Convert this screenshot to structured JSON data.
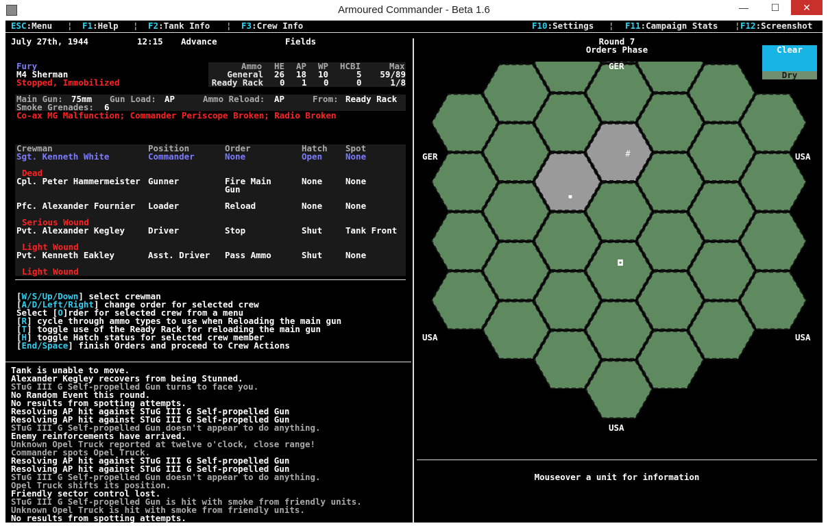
{
  "window": {
    "title": "Armoured Commander - Beta 1.6",
    "minimize": "—",
    "maximize": "☐",
    "close": "✕"
  },
  "menu": {
    "left": [
      {
        "key": "ESC",
        "label": ":Menu"
      },
      {
        "key": "F1",
        "label": ":Help"
      },
      {
        "key": "F2",
        "label": ":Tank Info"
      },
      {
        "key": "F3",
        "label": ":Crew Info"
      }
    ],
    "right": [
      {
        "key": "F10",
        "label": ":Settings"
      },
      {
        "key": "F11",
        "label": ":Campaign Stats"
      },
      {
        "key": "F12",
        "label": ":Screenshot"
      }
    ]
  },
  "status": {
    "date": "July 27th, 1944",
    "time": "12:15",
    "mission": "Advance",
    "terrain": "Fields"
  },
  "tank": {
    "name": "Fury",
    "model": "M4 Sherman",
    "state": "Stopped, Immobilized",
    "ammo_headers": [
      "Ammo",
      "HE",
      "AP",
      "WP",
      "HCBI",
      "Max"
    ],
    "ammo_rows": [
      {
        "label": "General",
        "he": "26",
        "ap": "18",
        "wp": "10",
        "hcbi": "5",
        "max": "59/89"
      },
      {
        "label": "Ready Rack",
        "he": "0",
        "ap": "1",
        "wp": "0",
        "hcbi": "0",
        "max": "1/8"
      }
    ],
    "main_gun_label": "Main Gun:",
    "main_gun": "75mm",
    "gun_load_label": "Gun Load:",
    "gun_load": "AP",
    "ammo_reload_label": "Ammo Reload:",
    "ammo_reload": "AP",
    "from_label": "From:",
    "from": "Ready Rack",
    "smoke_label": "Smoke Grenades:",
    "smoke": "6",
    "malfunctions": "Co-ax MG Malfunction; Commander Periscope Broken; Radio Broken"
  },
  "crew": {
    "headers": [
      "Crewman",
      "Position",
      "Order",
      "Hatch",
      "Spot"
    ],
    "rows": [
      {
        "name": "Sgt. Kenneth White",
        "position": "Commander",
        "order": "None",
        "order2": "",
        "hatch": "Open",
        "spot": "None",
        "status": "Dead",
        "selected": true
      },
      {
        "name": "Cpl. Peter Hammermeister",
        "position": "Gunner",
        "order": "Fire Main",
        "order2": "Gun",
        "hatch": "None",
        "spot": "None",
        "status": "",
        "selected": false
      },
      {
        "name": "Pfc. Alexander Fournier",
        "position": "Loader",
        "order": "Reload",
        "order2": "",
        "hatch": "None",
        "spot": "None",
        "status": "Serious Wound",
        "selected": false
      },
      {
        "name": "Pvt. Alexander Kegley",
        "position": "Driver",
        "order": "Stop",
        "order2": "",
        "hatch": "Shut",
        "spot": "Tank Front",
        "status": "Light Wound",
        "selected": false
      },
      {
        "name": "Pvt. Kenneth Eakley",
        "position": "Asst. Driver",
        "order": "Pass Ammo",
        "order2": "",
        "hatch": "Shut",
        "spot": "None",
        "status": "Light Wound",
        "selected": false
      }
    ]
  },
  "help": [
    {
      "pre": "[",
      "key": "W/S/Up/Down",
      "post": "] select crewman"
    },
    {
      "pre": "[",
      "key": "A/D/Left/Right",
      "post": "] change order for selected crew"
    },
    {
      "pre": "Select [",
      "key": "O",
      "post": "]rder for selected crew from a menu"
    },
    {
      "pre": "[",
      "key": "R",
      "post": "] cycle through ammo types to use when Reloading the main gun"
    },
    {
      "pre": "[",
      "key": "T",
      "post": "] toggle use of the Ready Rack for reloading the main gun"
    },
    {
      "pre": "[",
      "key": "H",
      "post": "] toggle Hatch status for selected crew member"
    },
    {
      "pre": "[",
      "key": "End/Space",
      "post": "] finish Orders and proceed to Crew Actions"
    }
  ],
  "log": [
    {
      "text": "Tank is unable to move.",
      "tone": "white"
    },
    {
      "text": "Alexander Kegley recovers from being Stunned.",
      "tone": "white"
    },
    {
      "text": "STuG III G Self-propelled Gun turns to face you.",
      "tone": "grey"
    },
    {
      "text": "No Random Event this round.",
      "tone": "white"
    },
    {
      "text": "No results from spotting attempts.",
      "tone": "white"
    },
    {
      "text": "Resolving AP hit against STuG III G Self-propelled Gun",
      "tone": "white"
    },
    {
      "text": "Resolving AP hit against STuG III G Self-propelled Gun",
      "tone": "white"
    },
    {
      "text": "STuG III G Self-propelled Gun doesn't appear to do anything.",
      "tone": "grey"
    },
    {
      "text": "Enemy reinforcements have arrived.",
      "tone": "white"
    },
    {
      "text": "Unknown Opel Truck reported at twelve o'clock, close range!",
      "tone": "grey"
    },
    {
      "text": "Commander spots Opel Truck.",
      "tone": "grey"
    },
    {
      "text": "Resolving AP hit against STuG III G Self-propelled Gun",
      "tone": "white"
    },
    {
      "text": "Resolving AP hit against STuG III G Self-propelled Gun",
      "tone": "white"
    },
    {
      "text": "STuG III G Self-propelled Gun doesn't appear to do anything.",
      "tone": "grey"
    },
    {
      "text": "Opel Truck shifts its position.",
      "tone": "grey"
    },
    {
      "text": "Friendly sector control lost.",
      "tone": "white"
    },
    {
      "text": "STuG III G Self-propelled Gun is hit with smoke from friendly units.",
      "tone": "grey"
    },
    {
      "text": "Unknown Opel Truck is hit with smoke from friendly units.",
      "tone": "grey"
    },
    {
      "text": "No results from spotting attempts.",
      "tone": "white"
    }
  ],
  "battle": {
    "round": "Round 7",
    "phase": "Orders Phase",
    "weather_top": "Clear",
    "weather_bottom": "Dry",
    "labels": {
      "top": "GER",
      "upper_left": "GER",
      "upper_right": "USA",
      "lower_left": "USA",
      "lower_right": "USA",
      "bottom": "USA"
    },
    "unit_info": "Mouseover a unit for information",
    "colors": {
      "hex_green": "#5f8a5f",
      "hex_grey": "#9a9a9a",
      "weather_sky": "#19b4e6",
      "weather_ground": "#6f8f6f"
    }
  }
}
